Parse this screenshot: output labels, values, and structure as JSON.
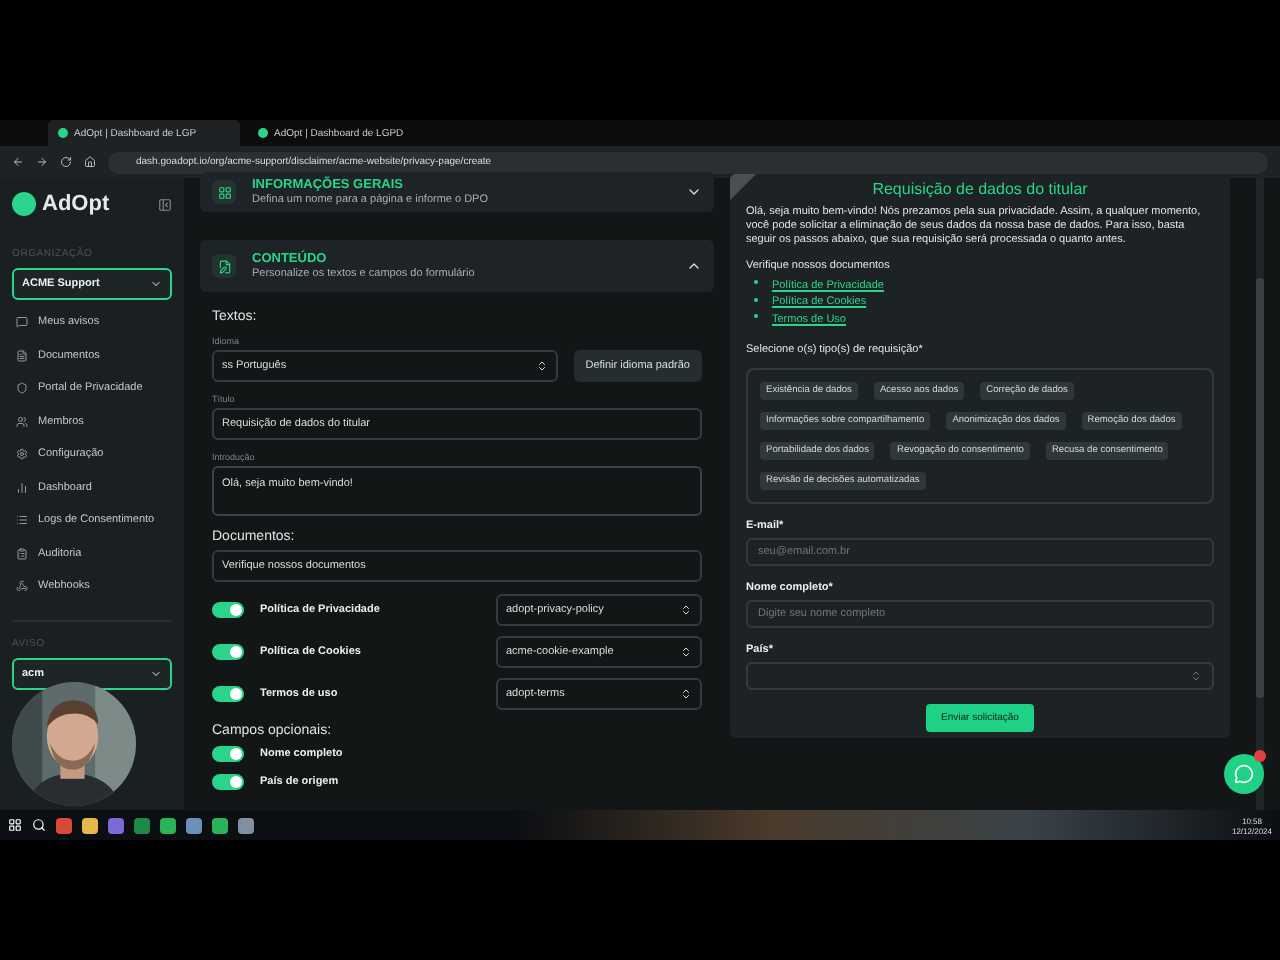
{
  "browser": {
    "tabs": [
      {
        "title": "AdOpt | Dashboard de LGP",
        "selected": true
      },
      {
        "title": "AdOpt | Dashboard de LGPD",
        "selected": false
      }
    ],
    "url": "dash.goadopt.io/org/acme-support/disclaimer/acme-website/privacy-page/create"
  },
  "sidebar": {
    "logo": "AdOpt",
    "org_label": "ORGANIZAÇÃO",
    "org_value": "ACME Support",
    "items": [
      {
        "label": "Meus avisos"
      },
      {
        "label": "Documentos"
      },
      {
        "label": "Portal de Privacidade"
      },
      {
        "label": "Membros"
      },
      {
        "label": "Configuração"
      },
      {
        "label": "Dashboard"
      },
      {
        "label": "Logs de Consentimento"
      },
      {
        "label": "Auditoria"
      },
      {
        "label": "Webhooks"
      }
    ],
    "notice_label": "AVISO",
    "notice_value": "acm"
  },
  "sections": [
    {
      "title": "INFORMAÇÕES GERAIS",
      "subtitle": "Defina um nome para a página e informe o DPO",
      "expanded": false
    },
    {
      "title": "CONTEÚDO",
      "subtitle": "Personalize os textos e campos do formulário",
      "expanded": true
    }
  ],
  "form": {
    "texts_heading": "Textos:",
    "language_label": "Idioma",
    "language_flag": "ss",
    "language_value": "Português",
    "default_language_button": "Definir idioma padrão",
    "title_label": "Título",
    "title_value": "Requisição de dados do titular",
    "intro_label": "Introdução",
    "intro_value": "Olá, seja muito bem-vindo!",
    "documents_heading": "Documentos:",
    "documents_value": "Verifique nossos documentos",
    "documents": [
      {
        "label": "Política de Privacidade",
        "on": true,
        "value": "adopt-privacy-policy"
      },
      {
        "label": "Política de Cookies",
        "on": true,
        "value": "acme-cookie-example"
      },
      {
        "label": "Termos de uso",
        "on": true,
        "value": "adopt-terms"
      }
    ],
    "optional_heading": "Campos opcionais:",
    "optional_fields": [
      {
        "label": "Nome completo",
        "on": true
      },
      {
        "label": "País de origem",
        "on": true
      }
    ]
  },
  "preview": {
    "title": "Requisição de dados do titular",
    "intro": "Olá, seja muito bem-vindo! Nós prezamos pela sua privacidade. Assim, a qualquer momento, você pode solicitar a eliminação de seus dados da nossa base de dados. Para isso, basta seguir os passos abaixo, que sua requisição será processada o quanto antes.",
    "documents_heading": "Verifique nossos documentos",
    "links": [
      "Política de Privacidade",
      "Política de Cookies",
      "Termos de Uso"
    ],
    "request_label": "Selecione o(s) tipo(s) de requisição*",
    "request_types": [
      "Existência de dados",
      "Acesso aos dados",
      "Correção de dados",
      "Informações sobre compartilhamento",
      "Anonimização dos dados",
      "Remoção dos dados",
      "Portabilidade dos dados",
      "Revogação do consentimento",
      "Recusa de consentimento",
      "Revisão de decisões automatizadas"
    ],
    "email_label": "E-mail*",
    "email_placeholder": "seu@email.com.br",
    "name_label": "Nome completo*",
    "name_placeholder": "Digite seu nome completo",
    "country_label": "País*",
    "submit": "Enviar solicitação"
  },
  "taskbar": {
    "time": "10:58",
    "date": "12/12/2024"
  }
}
